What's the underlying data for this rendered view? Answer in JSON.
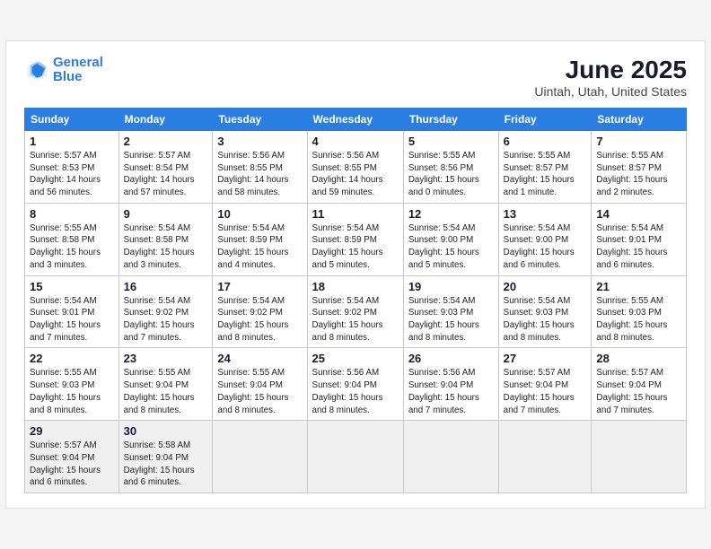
{
  "logo": {
    "line1": "General",
    "line2": "Blue"
  },
  "title": "June 2025",
  "subtitle": "Uintah, Utah, United States",
  "days_of_week": [
    "Sunday",
    "Monday",
    "Tuesday",
    "Wednesday",
    "Thursday",
    "Friday",
    "Saturday"
  ],
  "weeks": [
    [
      {
        "day": "1",
        "sunrise": "5:57 AM",
        "sunset": "8:53 PM",
        "daylight": "14 hours and 56 minutes."
      },
      {
        "day": "2",
        "sunrise": "5:57 AM",
        "sunset": "8:54 PM",
        "daylight": "14 hours and 57 minutes."
      },
      {
        "day": "3",
        "sunrise": "5:56 AM",
        "sunset": "8:55 PM",
        "daylight": "14 hours and 58 minutes."
      },
      {
        "day": "4",
        "sunrise": "5:56 AM",
        "sunset": "8:55 PM",
        "daylight": "14 hours and 59 minutes."
      },
      {
        "day": "5",
        "sunrise": "5:55 AM",
        "sunset": "8:56 PM",
        "daylight": "15 hours and 0 minutes."
      },
      {
        "day": "6",
        "sunrise": "5:55 AM",
        "sunset": "8:57 PM",
        "daylight": "15 hours and 1 minute."
      },
      {
        "day": "7",
        "sunrise": "5:55 AM",
        "sunset": "8:57 PM",
        "daylight": "15 hours and 2 minutes."
      }
    ],
    [
      {
        "day": "8",
        "sunrise": "5:55 AM",
        "sunset": "8:58 PM",
        "daylight": "15 hours and 3 minutes."
      },
      {
        "day": "9",
        "sunrise": "5:54 AM",
        "sunset": "8:58 PM",
        "daylight": "15 hours and 3 minutes."
      },
      {
        "day": "10",
        "sunrise": "5:54 AM",
        "sunset": "8:59 PM",
        "daylight": "15 hours and 4 minutes."
      },
      {
        "day": "11",
        "sunrise": "5:54 AM",
        "sunset": "8:59 PM",
        "daylight": "15 hours and 5 minutes."
      },
      {
        "day": "12",
        "sunrise": "5:54 AM",
        "sunset": "9:00 PM",
        "daylight": "15 hours and 5 minutes."
      },
      {
        "day": "13",
        "sunrise": "5:54 AM",
        "sunset": "9:00 PM",
        "daylight": "15 hours and 6 minutes."
      },
      {
        "day": "14",
        "sunrise": "5:54 AM",
        "sunset": "9:01 PM",
        "daylight": "15 hours and 6 minutes."
      }
    ],
    [
      {
        "day": "15",
        "sunrise": "5:54 AM",
        "sunset": "9:01 PM",
        "daylight": "15 hours and 7 minutes."
      },
      {
        "day": "16",
        "sunrise": "5:54 AM",
        "sunset": "9:02 PM",
        "daylight": "15 hours and 7 minutes."
      },
      {
        "day": "17",
        "sunrise": "5:54 AM",
        "sunset": "9:02 PM",
        "daylight": "15 hours and 8 minutes."
      },
      {
        "day": "18",
        "sunrise": "5:54 AM",
        "sunset": "9:02 PM",
        "daylight": "15 hours and 8 minutes."
      },
      {
        "day": "19",
        "sunrise": "5:54 AM",
        "sunset": "9:03 PM",
        "daylight": "15 hours and 8 minutes."
      },
      {
        "day": "20",
        "sunrise": "5:54 AM",
        "sunset": "9:03 PM",
        "daylight": "15 hours and 8 minutes."
      },
      {
        "day": "21",
        "sunrise": "5:55 AM",
        "sunset": "9:03 PM",
        "daylight": "15 hours and 8 minutes."
      }
    ],
    [
      {
        "day": "22",
        "sunrise": "5:55 AM",
        "sunset": "9:03 PM",
        "daylight": "15 hours and 8 minutes."
      },
      {
        "day": "23",
        "sunrise": "5:55 AM",
        "sunset": "9:04 PM",
        "daylight": "15 hours and 8 minutes."
      },
      {
        "day": "24",
        "sunrise": "5:55 AM",
        "sunset": "9:04 PM",
        "daylight": "15 hours and 8 minutes."
      },
      {
        "day": "25",
        "sunrise": "5:56 AM",
        "sunset": "9:04 PM",
        "daylight": "15 hours and 8 minutes."
      },
      {
        "day": "26",
        "sunrise": "5:56 AM",
        "sunset": "9:04 PM",
        "daylight": "15 hours and 7 minutes."
      },
      {
        "day": "27",
        "sunrise": "5:57 AM",
        "sunset": "9:04 PM",
        "daylight": "15 hours and 7 minutes."
      },
      {
        "day": "28",
        "sunrise": "5:57 AM",
        "sunset": "9:04 PM",
        "daylight": "15 hours and 7 minutes."
      }
    ],
    [
      {
        "day": "29",
        "sunrise": "5:57 AM",
        "sunset": "9:04 PM",
        "daylight": "15 hours and 6 minutes."
      },
      {
        "day": "30",
        "sunrise": "5:58 AM",
        "sunset": "9:04 PM",
        "daylight": "15 hours and 6 minutes."
      },
      null,
      null,
      null,
      null,
      null
    ]
  ]
}
